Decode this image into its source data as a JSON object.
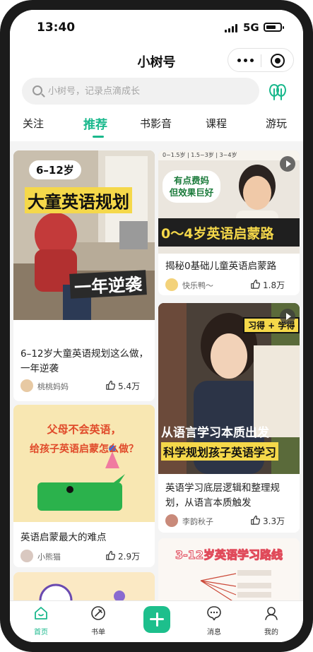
{
  "status_bar": {
    "time": "13:40",
    "network": "5G"
  },
  "app": {
    "title": "小树号"
  },
  "search": {
    "placeholder": "小树号，记录点滴成长"
  },
  "tabs": [
    {
      "label": "关注"
    },
    {
      "label": "推荐",
      "active": true
    },
    {
      "label": "书影音"
    },
    {
      "label": "课程"
    },
    {
      "label": "游玩"
    }
  ],
  "feed": {
    "cards": [
      {
        "title": "6–12岁大童英语规划这么做，一年逆袭",
        "author": "桃桃妈妈",
        "likes": "5.4万",
        "cover_text": {
          "age_bubble": "6–12岁",
          "headline": "大童英语规划",
          "sub": "一年逆袭"
        }
      },
      {
        "title": "揭秘0基础儿童英语启蒙路",
        "author": "快乐鸭～",
        "likes": "1.8万",
        "cover_text": {
          "header": "0~1.5岁 | 1.5~3岁 | 3~4岁",
          "bubble": "有点费妈 但效果巨好",
          "headline": "0～4岁英语启蒙路"
        }
      },
      {
        "title": "英语启蒙最大的难点",
        "author": "小熊猫",
        "likes": "2.9万",
        "cover_text": {
          "line1": "父母不会英语，",
          "line2": "给孩子英语启蒙怎么做？"
        }
      },
      {
        "title": "英语学习底层逻辑和整理规划，从语言本质触发",
        "author": "李韵秋子",
        "likes": "3.3万",
        "cover_text": {
          "badge": "习得 + 学得",
          "line1": "从语言学习本质出发",
          "line2": "科学规划孩子英语学习"
        }
      },
      {
        "cover_text": {
          "headline": "3-12岁英语学习路线"
        }
      }
    ]
  },
  "bottom_nav": [
    {
      "label": "首页",
      "icon": "home-icon",
      "active": true
    },
    {
      "label": "书单",
      "icon": "book-list-icon"
    },
    {
      "label": "",
      "icon": "add-icon"
    },
    {
      "label": "消息",
      "icon": "message-icon"
    },
    {
      "label": "我的",
      "icon": "profile-icon"
    }
  ],
  "colors": {
    "accent": "#19b88c",
    "background": "#f4f4f4",
    "frame": "#1b1b1b"
  }
}
